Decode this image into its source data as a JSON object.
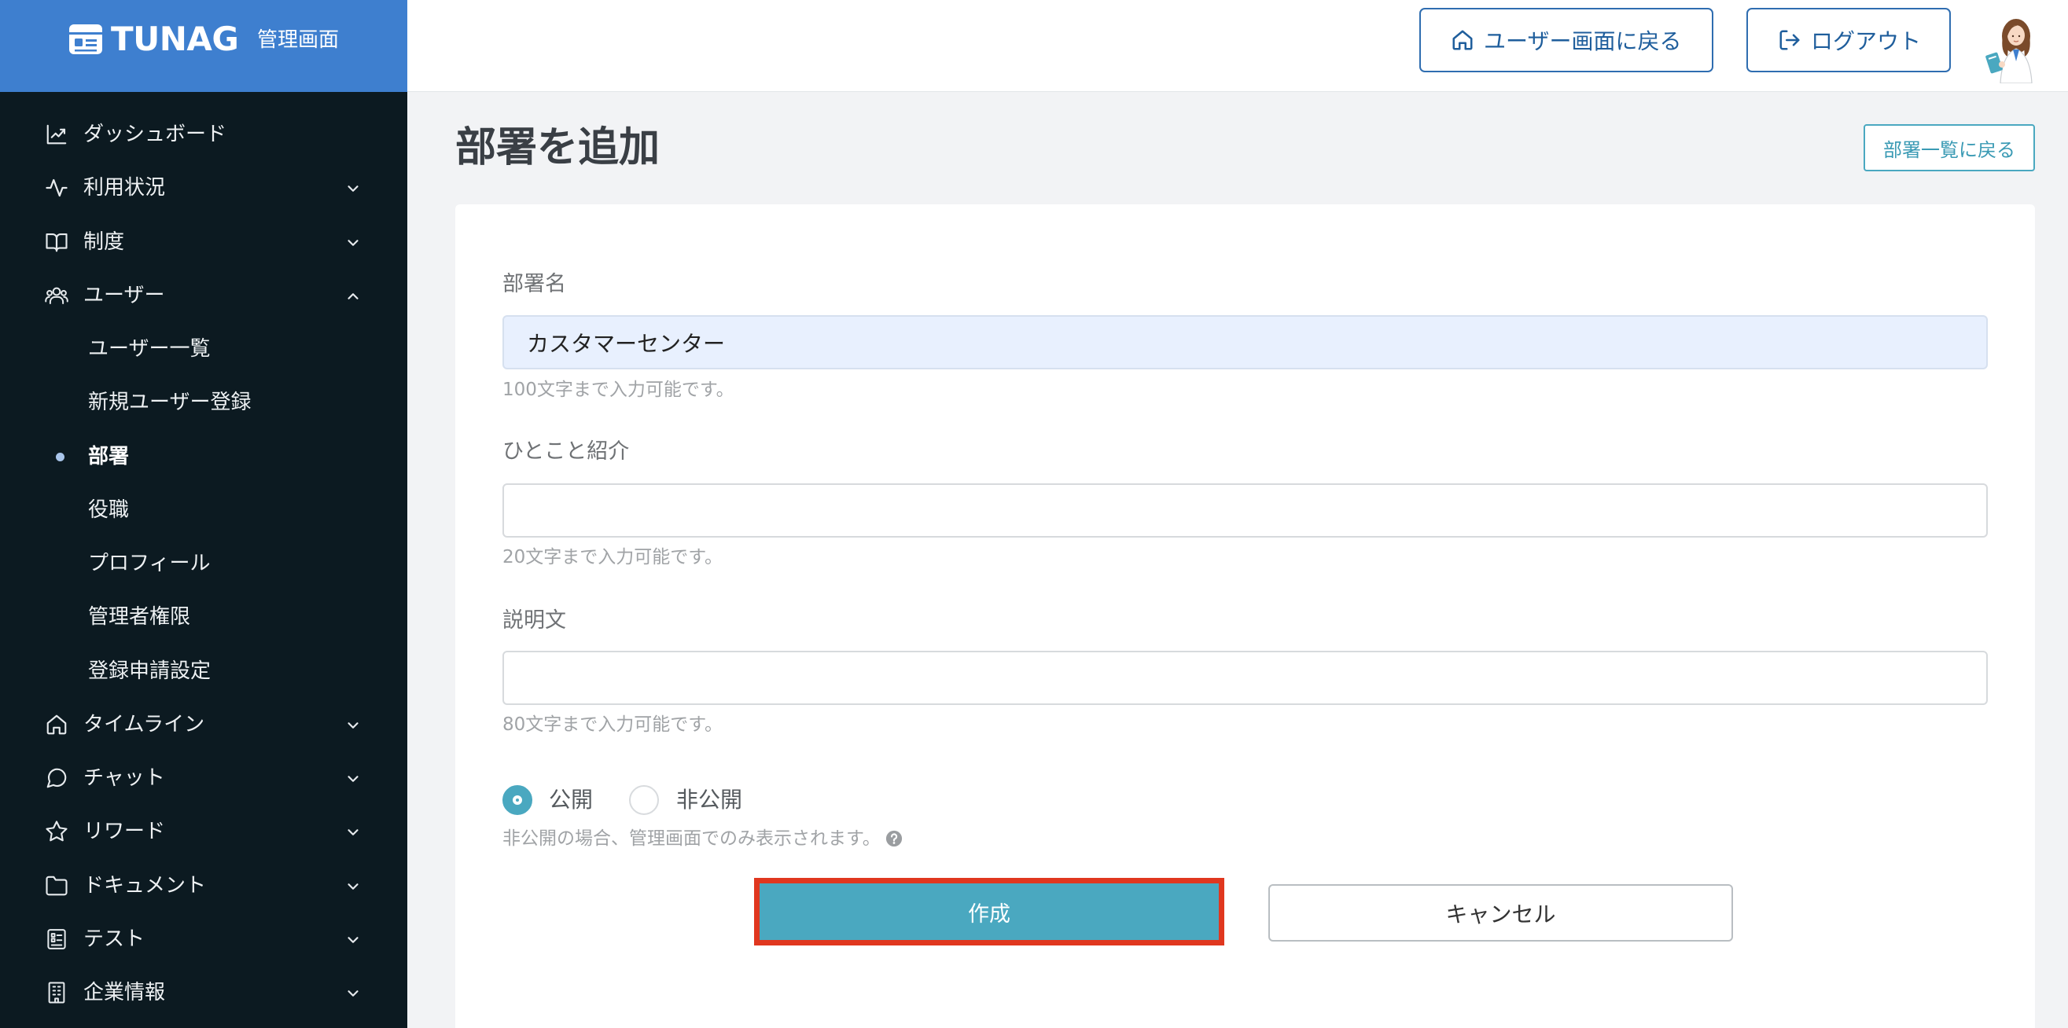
{
  "logo": {
    "brand": "TUNAG",
    "subtitle": "管理画面",
    "icon": "tunag-logo-icon"
  },
  "header": {
    "back_to_user_label": "ユーザー画面に戻る",
    "back_to_user_icon": "home-icon",
    "logout_label": "ログアウト",
    "logout_icon": "logout-icon",
    "avatar_icon": "user-avatar"
  },
  "sidebar": {
    "items": [
      {
        "label": "ダッシュボード",
        "icon": "chart-line-icon"
      },
      {
        "label": "利用状況",
        "icon": "activity-icon",
        "chevron": "chevron-down-icon"
      },
      {
        "label": "制度",
        "icon": "book-open-icon",
        "chevron": "chevron-down-icon"
      },
      {
        "label": "ユーザー",
        "icon": "users-icon",
        "chevron": "chevron-up-icon",
        "expanded": true,
        "children": [
          {
            "label": "ユーザー一覧"
          },
          {
            "label": "新規ユーザー登録"
          },
          {
            "label": "部署",
            "active": true
          },
          {
            "label": "役職"
          },
          {
            "label": "プロフィール"
          },
          {
            "label": "管理者権限"
          },
          {
            "label": "登録申請設定"
          }
        ]
      },
      {
        "label": "タイムライン",
        "icon": "home-icon",
        "chevron": "chevron-down-icon"
      },
      {
        "label": "チャット",
        "icon": "message-circle-icon",
        "chevron": "chevron-down-icon"
      },
      {
        "label": "リワード",
        "icon": "star-icon",
        "chevron": "chevron-down-icon"
      },
      {
        "label": "ドキュメント",
        "icon": "folder-icon",
        "chevron": "chevron-down-icon"
      },
      {
        "label": "テスト",
        "icon": "clipboard-list-icon",
        "chevron": "chevron-down-icon"
      },
      {
        "label": "企業情報",
        "icon": "building-icon",
        "chevron": "chevron-down-icon"
      }
    ]
  },
  "page": {
    "title": "部署を追加",
    "back_button_label": "部署一覧に戻る"
  },
  "form": {
    "name": {
      "label": "部署名",
      "value": "カスタマーセンター",
      "hint": "100文字まで入力可能です。"
    },
    "intro": {
      "label": "ひとこと紹介",
      "hint": "20文字まで入力可能です。"
    },
    "description": {
      "label": "説明文",
      "hint": "80文字まで入力可能です。"
    },
    "visibility": {
      "options": [
        {
          "label": "公開",
          "checked": true
        },
        {
          "label": "非公開",
          "checked": false
        }
      ],
      "hint": "非公開の場合、管理画面でのみ表示されます。",
      "hint_icon": "help-icon"
    },
    "submit_label": "作成",
    "cancel_label": "キャンセル"
  },
  "colors": {
    "brand_blue": "#3e7fcf",
    "sidebar_bg": "#0c1a21",
    "accent_teal": "#4aa8c0",
    "header_button_blue": "#2f6db0",
    "highlight_red": "#e0371f",
    "page_bg": "#f2f3f5"
  }
}
